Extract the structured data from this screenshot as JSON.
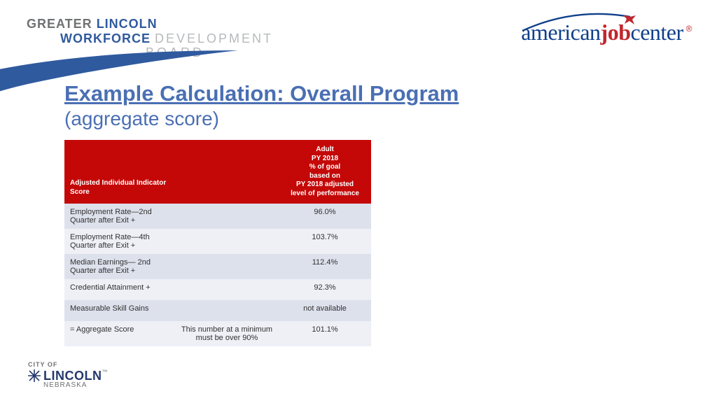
{
  "brand_left": {
    "line1_greater": "GREATER",
    "line1_lincoln": "LINCOLN",
    "line2_workforce": "WORKFORCE",
    "line2_development": "DEVELOPMENT",
    "line3_board": "BOARD"
  },
  "brand_right": {
    "american": "american",
    "job": "job",
    "center": "center",
    "reg": "®"
  },
  "title": {
    "main": "Example Calculation: Overall Program",
    "sub": "(aggregate score)"
  },
  "table": {
    "headers": {
      "col1": "Adjusted Individual Indicator Score",
      "col2": "",
      "col3": "Adult\nPY 2018\n% of goal\nbased on\nPY 2018 adjusted\nlevel of performance"
    },
    "rows": [
      {
        "indicator": "Employment Rate—2nd Quarter after Exit  +",
        "note": "",
        "value": "96.0%"
      },
      {
        "indicator": "Employment Rate—4th Quarter after Exit  +",
        "note": "",
        "value": "103.7%"
      },
      {
        "indicator": "Median Earnings— 2nd Quarter after Exit +",
        "note": "",
        "value": "112.4%"
      },
      {
        "indicator": "Credential Attainment +",
        "note": "",
        "value": "92.3%"
      },
      {
        "indicator": "Measurable Skill Gains",
        "note": "",
        "value": "not available"
      },
      {
        "indicator": "= Aggregate Score",
        "note": "This number at a minimum must be over 90%",
        "value": "101.1%"
      }
    ]
  },
  "footer_logo": {
    "city_of": "CITY OF",
    "lincoln": "LINCOLN",
    "tm": "™",
    "nebraska": "NEBRASKA"
  }
}
